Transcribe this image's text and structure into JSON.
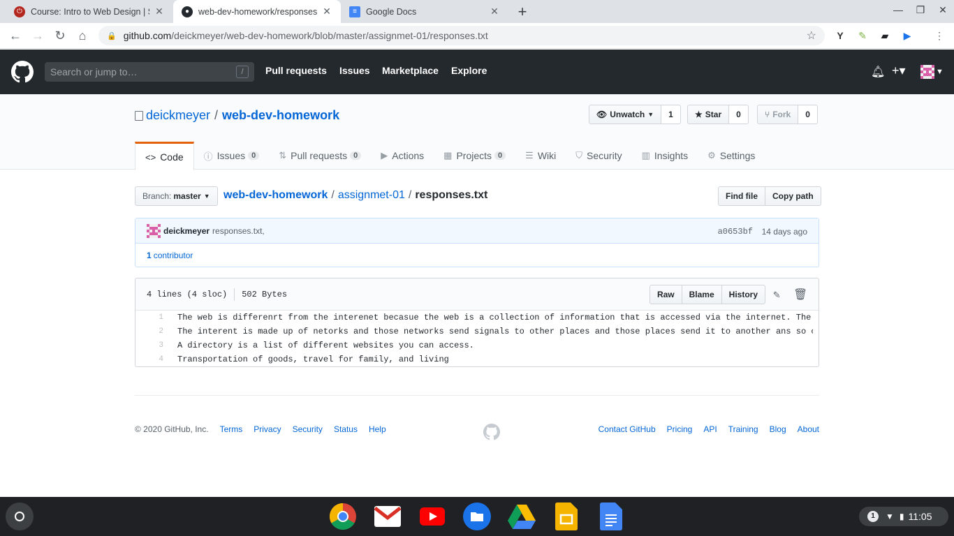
{
  "browser": {
    "tabs": [
      {
        "title": "Course: Intro to Web Design | Sp",
        "active": false
      },
      {
        "title": "web-dev-homework/responses.txt",
        "active": true
      },
      {
        "title": "Google Docs",
        "active": false
      }
    ],
    "url_host": "github.com",
    "url_path": "/deickmeyer/web-dev-homework/blob/master/assignmet-01/responses.txt"
  },
  "gh_header": {
    "search_placeholder": "Search or jump to…",
    "slash_hint": "/",
    "nav": [
      "Pull requests",
      "Issues",
      "Marketplace",
      "Explore"
    ]
  },
  "repo": {
    "owner": "deickmeyer",
    "name": "web-dev-homework",
    "separator": "/",
    "watch_label": "Unwatch",
    "watch_count": "1",
    "star_label": "Star",
    "star_count": "0",
    "fork_label": "Fork",
    "fork_count": "0"
  },
  "reponav": [
    {
      "label": "Code",
      "count": ""
    },
    {
      "label": "Issues",
      "count": "0"
    },
    {
      "label": "Pull requests",
      "count": "0"
    },
    {
      "label": "Actions",
      "count": ""
    },
    {
      "label": "Projects",
      "count": "0"
    },
    {
      "label": "Wiki",
      "count": ""
    },
    {
      "label": "Security",
      "count": ""
    },
    {
      "label": "Insights",
      "count": ""
    },
    {
      "label": "Settings",
      "count": ""
    }
  ],
  "filenav": {
    "branch_prefix": "Branch:",
    "branch": "master",
    "crumb_root": "web-dev-homework",
    "crumb_dir": "assignmet-01",
    "crumb_file": "responses.txt",
    "sep": "/",
    "find_file": "Find file",
    "copy_path": "Copy path"
  },
  "commit": {
    "author": "deickmeyer",
    "message": "responses.txt,",
    "sha": "a0653bf",
    "time": "14 days ago",
    "contributors_count": "1",
    "contributors_label": "contributor"
  },
  "file": {
    "lines_info": "4 lines (4 sloc)",
    "size": "502 Bytes",
    "raw": "Raw",
    "blame": "Blame",
    "history": "History",
    "lines": [
      {
        "num": "1",
        "text": "The web is differenrt from the interenet becasue the web is a collection of information that is accessed via the internet. The Inte"
      },
      {
        "num": "2",
        "text": "The interent is made up of netorks and those networks send signals to other places and those places send it to another ans so on an"
      },
      {
        "num": "3",
        "text": "A directory is a list of different websites you can access."
      },
      {
        "num": "4",
        "text": "Transportation of goods, travel for family, and living"
      }
    ]
  },
  "footer": {
    "copyright": "© 2020 GitHub, Inc.",
    "left_links": [
      "Terms",
      "Privacy",
      "Security",
      "Status",
      "Help"
    ],
    "right_links": [
      "Contact GitHub",
      "Pricing",
      "API",
      "Training",
      "Blog",
      "About"
    ]
  },
  "shelf": {
    "notification_count": "1",
    "time": "11:05"
  },
  "colors": {
    "github_header": "#24292e",
    "link": "#0366d6",
    "active_tab_accent": "#e36209"
  }
}
